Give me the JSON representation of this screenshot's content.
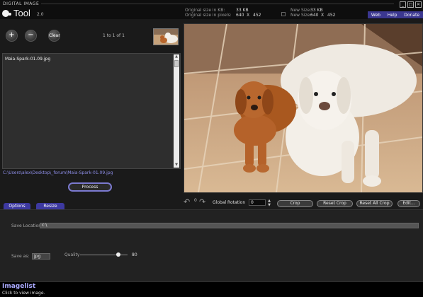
{
  "app": {
    "brand_small": "DIGITAL IMAGE",
    "name": "Tool",
    "version": "2.0"
  },
  "info": {
    "orig_kb_label": "Original size in KB:",
    "orig_kb_value": "33 KB",
    "orig_px_label": "Original size in pixels:",
    "orig_w": "640",
    "orig_x": "X",
    "orig_h": "452",
    "new_size_label": "New Size:",
    "new_kb_value": "33 KB",
    "new_w": "640",
    "new_x": "X",
    "new_h": "452"
  },
  "links": [
    "Web",
    "Help",
    "Donate"
  ],
  "list_controls": {
    "add": "+",
    "remove": "−",
    "clear": "Clear",
    "counter": "1 to 1 of 1"
  },
  "files": [
    "Maia-Spark-01.09.jpg"
  ],
  "selected_path": "C:\\Users\\alex\\Desktop\\_forum\\Maia-Spark-01.09.jpg",
  "process_label": "Process",
  "tabs": [
    "Options",
    "Resize"
  ],
  "rotation": {
    "zero": "0",
    "label": "Global Rotation",
    "value": "0"
  },
  "buttons": {
    "crop": "Crop",
    "reset_crop": "Reset Crop",
    "reset_all_crop": "Reset All Crop",
    "edit": "Edit..."
  },
  "options": {
    "save_location_label": "Save Location:",
    "save_location_value": "c:\\",
    "save_as_label": "Save as:",
    "save_as_value": "jpg",
    "quality_label": "Quality",
    "quality_value": "80",
    "quality_fraction": 0.8
  },
  "status": {
    "title": "Imagelist",
    "subtitle": "Click to view image."
  },
  "colors": {
    "accent": "#3b3790",
    "tab": "#3d39a0",
    "path_text": "#8e8ee8",
    "status_title": "#aaaaff"
  }
}
